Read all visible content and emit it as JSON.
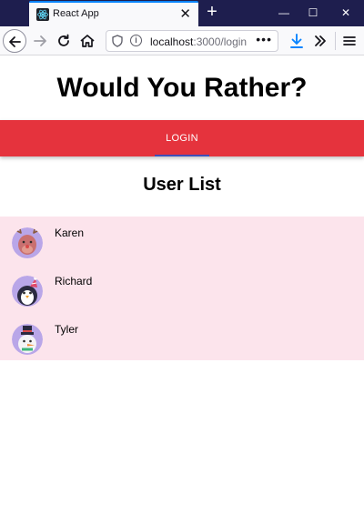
{
  "browser": {
    "tab_title": "React App",
    "url_host": "localhost",
    "url_path": ":3000/login"
  },
  "app": {
    "title": "Would You Rather?",
    "nav_login": "LOGIN",
    "user_list_title": "User List",
    "accent_color": "#e5333d",
    "list_background": "#fce4ec"
  },
  "users": [
    {
      "name": "Karen",
      "avatar_icon": "reindeer-avatar-icon"
    },
    {
      "name": "Richard",
      "avatar_icon": "penguin-avatar-icon"
    },
    {
      "name": "Tyler",
      "avatar_icon": "snowman-avatar-icon"
    }
  ]
}
